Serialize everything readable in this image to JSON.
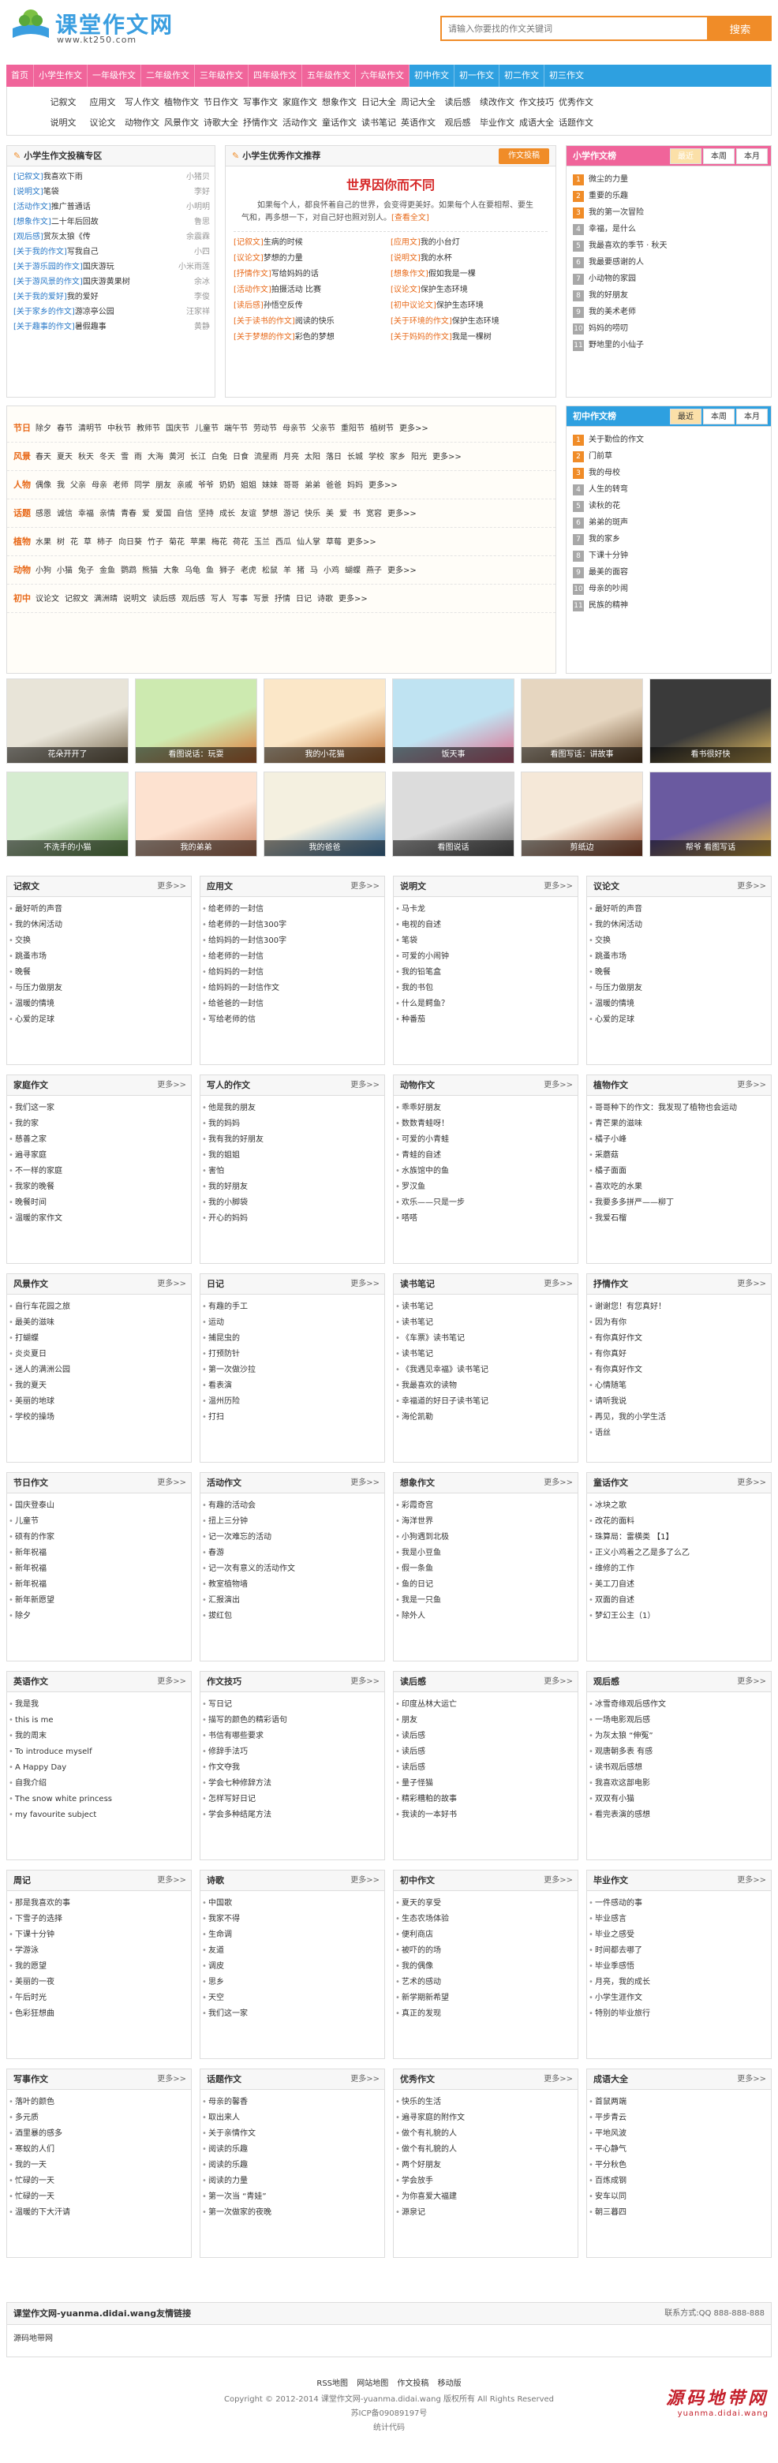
{
  "logo": {
    "name": "课堂作文网",
    "url": "www.kt250.com"
  },
  "search": {
    "placeholder": "请输入你要找的作文关键词",
    "button": "搜索"
  },
  "nav": {
    "items": [
      "首页",
      "小学生作文",
      "一年级作文",
      "二年级作文",
      "三年级作文",
      "四年级作文",
      "五年级作文",
      "六年级作文"
    ],
    "items_blue": [
      "初中作文",
      "初一作文",
      "初二作文",
      "初三作文"
    ]
  },
  "subnav": {
    "row1": [
      "记叙文",
      "应用文",
      "写人作文",
      "植物作文",
      "节日作文",
      "写事作文",
      "家庭作文",
      "想象作文",
      "日记大全",
      "周记大全",
      "读后感",
      "续改作文",
      "作文技巧",
      "优秀作文"
    ],
    "row2": [
      "说明文",
      "议论文",
      "动物作文",
      "风景作文",
      "诗歌大全",
      "抒情作文",
      "活动作文",
      "童话作文",
      "读书笔记",
      "英语作文",
      "观后感",
      "毕业作文",
      "成语大全",
      "话题作文"
    ]
  },
  "submit": {
    "title": "小学生作文投稿专区",
    "items": [
      {
        "tag": "[记叙文]",
        "title": "我喜欢下雨",
        "author": "小猪贝"
      },
      {
        "tag": "[说明文]",
        "title": "笔袋",
        "author": "李好"
      },
      {
        "tag": "[活动作文]",
        "title": "推广普通话",
        "author": "小明明"
      },
      {
        "tag": "[想象作文]",
        "title": "二十年后回故",
        "author": "鲁思"
      },
      {
        "tag": "[观后感]",
        "title": "赏灰太狼《传",
        "author": "余震霖"
      },
      {
        "tag": "[关于我的作文]",
        "title": "写我自己",
        "author": "小四"
      },
      {
        "tag": "[关于游乐园的作文]",
        "title": "国庆游玩",
        "author": "小米雨莲"
      },
      {
        "tag": "[关于游风景的作文]",
        "title": "国庆游黄果树",
        "author": "余冰"
      },
      {
        "tag": "[关于我的爱好]",
        "title": "我的爱好",
        "author": "李俊"
      },
      {
        "tag": "[关于家乡的作文]",
        "title": "游凉亭公园",
        "author": "汪家祥"
      },
      {
        "tag": "[关于趣事的作文]",
        "title": "暑假趣事",
        "author": "黄静"
      }
    ]
  },
  "recommend": {
    "title": "小学生优秀作文推荐",
    "button": "作文投稿",
    "headline": "世界因你而不同",
    "summary": "如果每个人，都良怀着自己的世界，会变得更美好。如果每个人在要相帮、要生气和，再多想一下，对自己好也照对别人。",
    "detail": "[查看全文]",
    "items": [
      [
        "[记叙文]",
        "生病的时候",
        "[应用文]",
        "我的小台灯"
      ],
      [
        "[议论文]",
        "梦想的力量",
        "[说明文]",
        "我的水杯"
      ],
      [
        "[抒情作文]",
        "写给妈妈的话",
        "[想象作文]",
        "假如我是一棵"
      ],
      [
        "[活动作文]",
        "拍摄活动 比赛",
        "[议论文]",
        "保护生态环境"
      ],
      [
        "[读后感]",
        "孙悟空反传",
        "[初中议论文]",
        "保护生态环境"
      ],
      [
        "[关于读书的作文]",
        "阅读的快乐",
        "[关于环境的作文]",
        "保护生态环境"
      ],
      [
        "[关于梦想的作文]",
        "彩色的梦想",
        "[关于妈妈的作文]",
        "我是一棵树"
      ]
    ]
  },
  "ranking1": {
    "title": "小学作文榜",
    "tabs": [
      "最近",
      "本周",
      "本月"
    ],
    "items": [
      "微尘的力量",
      "重要的乐趣",
      "我的第一次冒险",
      "幸福，是什么",
      "我最喜欢的季节 · 秋天",
      "我最要感谢的人",
      "小动物的家园",
      "我的好朋友",
      "我的美术老师",
      "妈妈的唠叨",
      "野地里的小仙子"
    ]
  },
  "tags": [
    {
      "label": "节日",
      "items": [
        "除夕",
        "春节",
        "清明节",
        "中秋节",
        "教师节",
        "国庆节",
        "儿童节",
        "端午节",
        "劳动节",
        "母亲节",
        "父亲节",
        "重阳节",
        "植树节",
        "更多>>"
      ]
    },
    {
      "label": "风景",
      "items": [
        "春天",
        "夏天",
        "秋天",
        "冬天",
        "雪",
        "雨",
        "大海",
        "黄河",
        "长江",
        "白兔",
        "日食",
        "流星雨",
        "月亮",
        "太阳",
        "落日",
        "长城",
        "学校",
        "家乡",
        "阳光",
        "更多>>"
      ]
    },
    {
      "label": "人物",
      "items": [
        "偶像",
        "我",
        "父亲",
        "母亲",
        "老师",
        "同学",
        "朋友",
        "亲戚",
        "爷爷",
        "奶奶",
        "姐姐",
        "妹妹",
        "哥哥",
        "弟弟",
        "爸爸",
        "妈妈",
        "更多>>"
      ]
    },
    {
      "label": "话题",
      "items": [
        "感恩",
        "诚信",
        "幸福",
        "亲情",
        "青春",
        "爱",
        "爱国",
        "自信",
        "坚持",
        "成长",
        "友谊",
        "梦想",
        "游记",
        "快乐",
        "美",
        "爱",
        "书",
        "宽容",
        "更多>>"
      ]
    },
    {
      "label": "植物",
      "items": [
        "水果",
        "树",
        "花",
        "草",
        "柿子",
        "向日葵",
        "竹子",
        "菊花",
        "苹果",
        "梅花",
        "荷花",
        "玉兰",
        "西瓜",
        "仙人掌",
        "草莓",
        "更多>>"
      ]
    },
    {
      "label": "动物",
      "items": [
        "小狗",
        "小猫",
        "兔子",
        "金鱼",
        "鹦鹉",
        "熊猫",
        "大象",
        "乌龟",
        "鱼",
        "狮子",
        "老虎",
        "松鼠",
        "羊",
        "猪",
        "马",
        "小鸡",
        "蝴蝶",
        "燕子",
        "更多>>"
      ]
    },
    {
      "label": "初中",
      "items": [
        "议论文",
        "记叙文",
        "满洲晴",
        "说明文",
        "读后感",
        "观后感",
        "写人",
        "写事",
        "写景",
        "抒情",
        "日记",
        "诗歌",
        "更多>>"
      ]
    }
  ],
  "ranking2": {
    "title": "初中作文榜",
    "tabs": [
      "最近",
      "本周",
      "本月"
    ],
    "items": [
      "关于勤俭的作文",
      "门前草",
      "我的母校",
      "人生的转弯",
      "读秋的花",
      "弟弟的斑声",
      "我的家乡",
      "下课十分钟",
      "最美的面容",
      "母亲的吵闹",
      "民族的精神"
    ]
  },
  "thumbs": [
    "花朵开开了",
    "看图说话：玩耍",
    "我的小花猫",
    "饭天事",
    "看图写话：讲故事",
    "看书很好快",
    "不洗手的小猫",
    "我的弟弟",
    "我的爸爸",
    "看图说话",
    "剪纸边",
    "帮爷 看图写话"
  ],
  "columns": [
    {
      "title": "记叙文",
      "more": "更多>>",
      "items": [
        "最好听的声音",
        "我的休闲活动",
        "交换",
        "跳蚤市场",
        "晚餐",
        "与压力做朋友",
        "温暖的情境",
        "心爱的足球"
      ]
    },
    {
      "title": "应用文",
      "more": "更多>>",
      "items": [
        "给老师的一封信",
        "给老师的一封信300字",
        "给妈妈的一封信300字",
        "给老师的一封信",
        "给妈妈的一封信",
        "给妈妈的一封信作文",
        "给爸爸的一封信",
        "写给老师的信"
      ]
    },
    {
      "title": "说明文",
      "more": "更多>>",
      "items": [
        "马卡龙",
        "电视的自述",
        "笔袋",
        "可爱的小闹钟",
        "我的铅笔盒",
        "我的书包",
        "什么是鳄鱼？",
        "种番茄"
      ]
    },
    {
      "title": "议论文",
      "more": "更多>>",
      "items": [
        "最好听的声音",
        "我的休闲活动",
        "交换",
        "跳蚤市场",
        "晚餐",
        "与压力做朋友",
        "温暖的情境",
        "心爱的足球"
      ]
    },
    {
      "title": "家庭作文",
      "more": "更多>>",
      "items": [
        "我们这一家",
        "我的家",
        "慈善之家",
        "遍寻家庭",
        "不一样的家庭",
        "我家的晚餐",
        "晚餐时间",
        "温暖的家作文"
      ]
    },
    {
      "title": "写人的作文",
      "more": "更多>>",
      "items": [
        "他是我的朋友",
        "我的妈妈",
        "我有我的好朋友",
        "我的姐姐",
        "害怕",
        "我的好朋友",
        "我的小脚袋",
        "开心的妈妈"
      ]
    },
    {
      "title": "动物作文",
      "more": "更多>>",
      "items": [
        "乖乖好朋友",
        "数数青蛙呀！",
        "可爱的小青蛙",
        "青蛙的自述",
        "水族馆中的鱼",
        "罗汉鱼",
        "欢乐——只是一步",
        "嗒嗒"
      ]
    },
    {
      "title": "植物作文",
      "more": "更多>>",
      "items": [
        "哥哥种下的作文：我发现了植物也会运动",
        "青芒果的滋味",
        "橘子小峰",
        "采蘑菇",
        "橘子面面",
        "喜欢吃的水果",
        "我要多多拼严——柳丁",
        "我爱石榴"
      ]
    },
    {
      "title": "风景作文",
      "more": "更多>>",
      "items": [
        "自行车花园之旅",
        "最美的滋味",
        "打蝴蝶",
        "炎炎夏日",
        "迷人的满洲公园",
        "我的夏天",
        "美丽的地球",
        "学校的操场"
      ]
    },
    {
      "title": "日记",
      "more": "更多>>",
      "items": [
        "有趣的手工",
        "运动",
        "捕昆虫的",
        "打预防针",
        "第一次做沙拉",
        "看表演",
        "温州历险",
        "打扫"
      ]
    },
    {
      "title": "读书笔记",
      "more": "更多>>",
      "items": [
        "读书笔记",
        "读书笔记",
        "《车票》读书笔记",
        "读书笔记",
        "《我遇见幸福》读书笔记",
        "我最喜欢的读物",
        "幸福道的好日子读书笔记",
        "海伦凯勒"
      ]
    },
    {
      "title": "抒情作文",
      "more": "更多>>",
      "items": [
        "谢谢您！有您真好！",
        "因为有你",
        "有你真好作文",
        "有你真好",
        "有你真好作文",
        "心情随笔",
        "请听我说",
        "再见，我的小学生活",
        "语丝"
      ]
    },
    {
      "title": "节日作文",
      "more": "更多>>",
      "items": [
        "国庆登泰山",
        "儿童节",
        "硕有的作家",
        "新年祝福",
        "新年祝福",
        "新年祝福",
        "新年新愿望",
        "除夕"
      ]
    },
    {
      "title": "活动作文",
      "more": "更多>>",
      "items": [
        "有趣的活动会",
        "扭上三分钟",
        "记一次难忘的活动",
        "春游",
        "记一次有意义的活动作文",
        "教室植物墙",
        "汇报演出",
        "拔红包"
      ]
    },
    {
      "title": "想象作文",
      "more": "更多>>",
      "items": [
        "彩霞奇宫",
        "海洋世界",
        "小狗遇到北极",
        "我是小豆鱼",
        "假一条鱼",
        "鱼的日记",
        "我是一只鱼",
        "除外人"
      ]
    },
    {
      "title": "童话作文",
      "more": "更多>>",
      "items": [
        "冰块之歌",
        "改花的面料",
        "珠算局：雷横类 【1】",
        "正义小鸡着之乙是多了么乙",
        "维修的工作",
        "美工刀自述",
        "双面的自述",
        "梦幻王公主（1）"
      ]
    },
    {
      "title": "英语作文",
      "more": "更多>>",
      "items": [
        "我是我",
        "this is me",
        "我的周末",
        "To introduce myself",
        "A Happy Day",
        "自我介绍",
        "The snow white princess",
        "my favourite subject"
      ]
    },
    {
      "title": "作文技巧",
      "more": "更多>>",
      "items": [
        "写日记",
        "描写的颜色的精彩语句",
        "书信有哪些要求",
        "修辞手法巧",
        "作文夺我",
        "学会七种修辞方法",
        "怎样写好日记",
        "学会多种结尾方法"
      ]
    },
    {
      "title": "读后感",
      "more": "更多>>",
      "items": [
        "印度丛林大运亡",
        "朋友",
        "读后感",
        "读后感",
        "读后感",
        "量子怪猫",
        "精彩糟粕的故事",
        "我读的一本好书"
      ]
    },
    {
      "title": "观后感",
      "more": "更多>>",
      "items": [
        "冰雪奇缘观后感作文",
        "一场电影观后感",
        "为灰太狼 “伸冤”",
        "观唐朝多表 有感",
        "读书观后感想",
        "我喜欢这部电影",
        "双双有小猫",
        "看完表演的感想"
      ]
    },
    {
      "title": "周记",
      "more": "更多>>",
      "items": [
        "那是我喜欢的事",
        "下雪子的选择",
        "下课十分钟",
        "学游泳",
        "我的愿望",
        "美丽的一夜",
        "午后时光",
        "色彩狂想曲"
      ]
    },
    {
      "title": "诗歌",
      "more": "更多>>",
      "items": [
        "中国歌",
        "我家不得",
        "生命调",
        "友道",
        "调皮",
        "思乡",
        "天空",
        "我们这一家"
      ]
    },
    {
      "title": "初中作文",
      "more": "更多>>",
      "items": [
        "夏天的享受",
        "生态农场体验",
        "便利商店",
        "被吓的的场",
        "我的偶像",
        "艺术的感动",
        "新学期新希望",
        "真正的发现"
      ]
    },
    {
      "title": "毕业作文",
      "more": "更多>>",
      "items": [
        "一件感动的事",
        "毕业感言",
        "毕业之感受",
        "时间都去哪了",
        "毕业季感悟",
        "月亮，我的成长",
        "小学生涯作文",
        "特别的毕业旅行"
      ]
    },
    {
      "title": "写事作文",
      "more": "更多>>",
      "items": [
        "落叶的颜色",
        "多元质",
        "酒里暴的感多",
        "寒蚁的人们",
        "我的一天",
        "忙碌的一天",
        "忙碌的一天",
        "温暖的下大汗请"
      ]
    },
    {
      "title": "话题作文",
      "more": "更多>>",
      "items": [
        "母亲的馨香",
        "取出来人",
        "关于亲情作文",
        "阅读的乐趣",
        "阅读的乐趣",
        "阅读的力量",
        "第一次当 “青娃”",
        "第一次做家的夜晚"
      ]
    },
    {
      "title": "优秀作文",
      "more": "更多>>",
      "items": [
        "快乐的生活",
        "遍寻家庭的附作文",
        "做个有礼貌的人",
        "做个有礼貌的人",
        "两个好朋友",
        "学会放手",
        "为你喜爱大福建",
        "源泉记"
      ]
    },
    {
      "title": "成语大全",
      "more": "更多>>",
      "items": [
        "首鼠两端",
        "平步青云",
        "平地风波",
        "平心静气",
        "平分秋色",
        "百炼成钢",
        "安车以同",
        "朝三暮四"
      ]
    }
  ],
  "friendlinks": {
    "title": "课堂作文网-yuanma.didai.wang友情链接",
    "contact": "联系方式:QQ 888-888-888",
    "items": [
      "源码地带网"
    ]
  },
  "footer": {
    "links": [
      "RSS地图",
      "网站地图",
      "作文投稿",
      "移动版"
    ],
    "copyright": "Copyright © 2012-2014 课堂作文网-yuanma.didai.wang 版权所有 All Rights Reserved",
    "icp": "苏ICP备09089197号",
    "stats": "统计代码"
  },
  "watermark": {
    "line1": "源码地带网",
    "line2": "yuanma.didai.wang"
  },
  "colors": {
    "pink": "#f0649a",
    "blue": "#2ea0e0",
    "orange": "#f08c28",
    "red": "#d62828"
  }
}
